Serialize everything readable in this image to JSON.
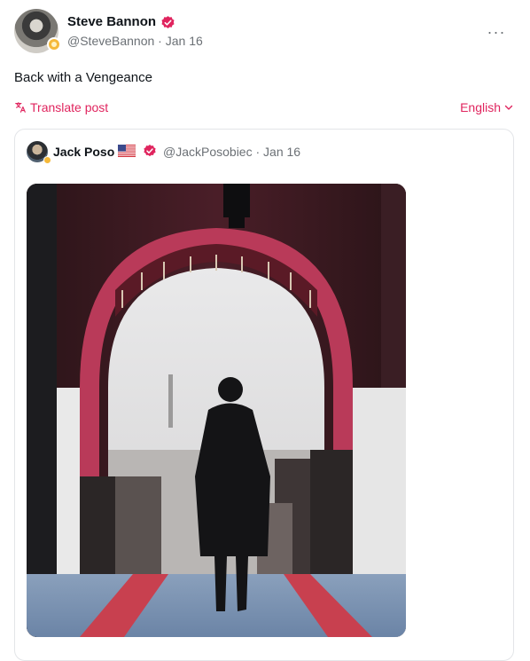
{
  "post": {
    "author": {
      "name": "Steve Bannon",
      "handle": "@SteveBannon",
      "separator": "·",
      "date": "Jan 16"
    },
    "text": "Back with a Vengeance",
    "translate_label": "Translate post",
    "language_label": "English",
    "more_label": "···",
    "icons": [
      "avatar",
      "verified-badge-icon",
      "translate-icon",
      "chevron-down-icon",
      "more-icon"
    ],
    "accent_color": "#e0245e"
  },
  "quoted_post": {
    "author": {
      "name": "Jack Poso",
      "handle": "@JackPosobiec",
      "separator": "·",
      "date": "Jan 16"
    },
    "icons": [
      "us-flag-icon",
      "verified-badge-icon"
    ]
  }
}
